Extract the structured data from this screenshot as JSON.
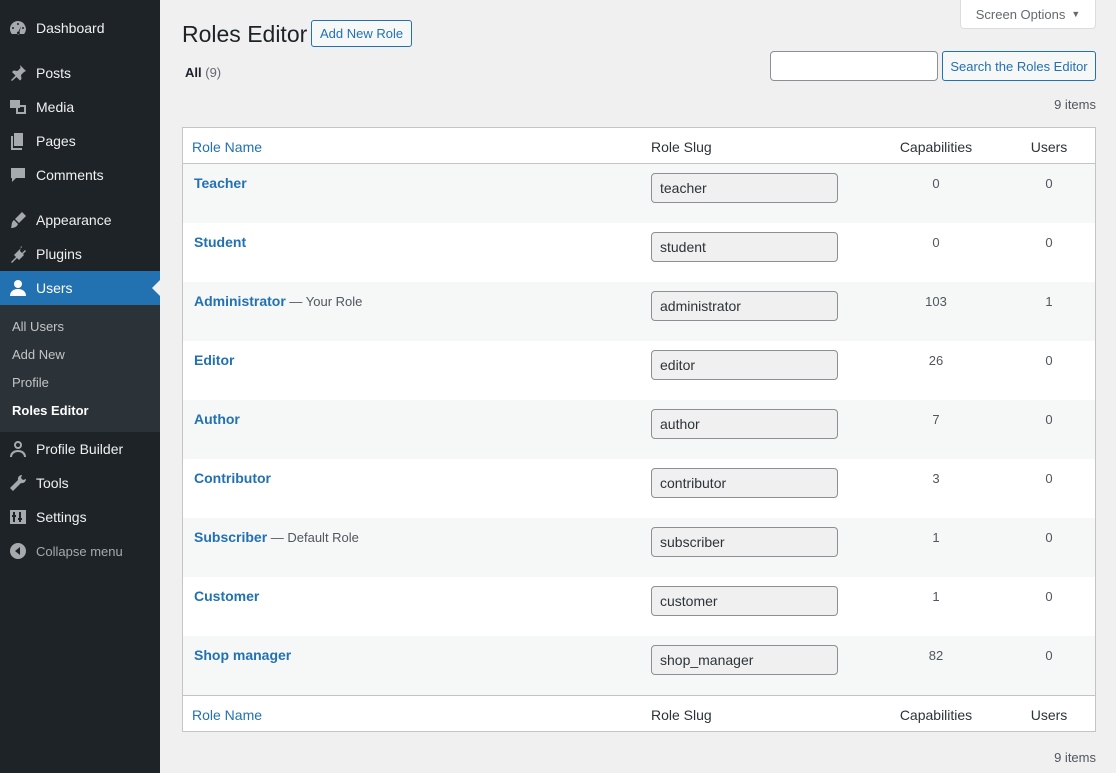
{
  "sidebar": {
    "menu": [
      {
        "label": "Dashboard",
        "icon": "dashboard-icon"
      },
      {
        "label": "Posts",
        "icon": "pin-icon"
      },
      {
        "label": "Media",
        "icon": "media-icon"
      },
      {
        "label": "Pages",
        "icon": "pages-icon"
      },
      {
        "label": "Comments",
        "icon": "comment-icon"
      },
      {
        "label": "Appearance",
        "icon": "brush-icon"
      },
      {
        "label": "Plugins",
        "icon": "plug-icon"
      },
      {
        "label": "Users",
        "icon": "user-icon"
      },
      {
        "label": "Profile Builder",
        "icon": "person-outline-icon"
      },
      {
        "label": "Tools",
        "icon": "wrench-icon"
      },
      {
        "label": "Settings",
        "icon": "settings-sliders-icon"
      },
      {
        "label": "Collapse menu",
        "icon": "collapse-arrow-icon"
      }
    ],
    "submenu": [
      "All Users",
      "Add New",
      "Profile",
      "Roles Editor"
    ]
  },
  "header": {
    "title": "Roles Editor",
    "add_new_label": "Add New Role",
    "screen_options_label": "Screen Options"
  },
  "filter": {
    "all_label": "All",
    "all_count": "(9)"
  },
  "search": {
    "placeholder": "",
    "button_label": "Search the Roles Editor"
  },
  "items_count": "9 items",
  "table": {
    "columns": [
      "Role Name",
      "Role Slug",
      "Capabilities",
      "Users"
    ],
    "rows": [
      {
        "name": "Teacher",
        "note": "",
        "slug": "teacher",
        "capabilities": "0",
        "users": "0"
      },
      {
        "name": "Student",
        "note": "",
        "slug": "student",
        "capabilities": "0",
        "users": "0"
      },
      {
        "name": "Administrator",
        "note": " — Your Role",
        "slug": "administrator",
        "capabilities": "103",
        "users": "1"
      },
      {
        "name": "Editor",
        "note": "",
        "slug": "editor",
        "capabilities": "26",
        "users": "0"
      },
      {
        "name": "Author",
        "note": "",
        "slug": "author",
        "capabilities": "7",
        "users": "0"
      },
      {
        "name": "Contributor",
        "note": "",
        "slug": "contributor",
        "capabilities": "3",
        "users": "0"
      },
      {
        "name": "Subscriber",
        "note": " — Default Role",
        "slug": "subscriber",
        "capabilities": "1",
        "users": "0"
      },
      {
        "name": "Customer",
        "note": "",
        "slug": "customer",
        "capabilities": "1",
        "users": "0"
      },
      {
        "name": "Shop manager",
        "note": "",
        "slug": "shop_manager",
        "capabilities": "82",
        "users": "0"
      }
    ]
  },
  "colors": {
    "sidebar_bg": "#1d2327",
    "accent": "#2271b1",
    "page_bg": "#f0f0f1"
  }
}
